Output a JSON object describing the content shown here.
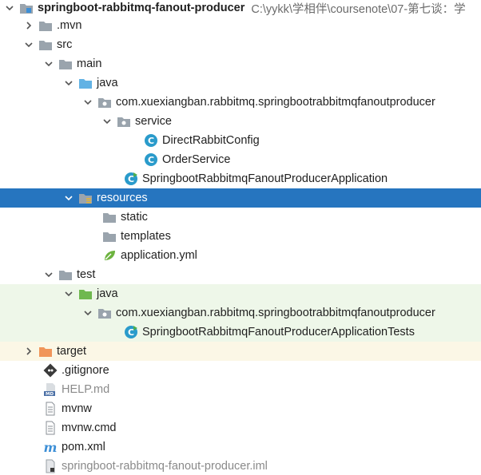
{
  "project": {
    "name": "springboot-rabbitmq-fanout-producer",
    "path": "C:\\yykk\\学相伴\\coursenote\\07-第七谈：学"
  },
  "nodes": {
    "mvn": ".mvn",
    "src": "src",
    "main": "main",
    "main_java": "java",
    "package_main": "com.xuexiangban.rabbitmq.springbootrabbitmqfanoutproducer",
    "service": "service",
    "direct_config": "DirectRabbitConfig",
    "order_service": "OrderService",
    "app_class": "SpringbootRabbitmqFanoutProducerApplication",
    "resources": "resources",
    "static": "static",
    "templates": "templates",
    "app_yml": "application.yml",
    "test": "test",
    "test_java": "java",
    "package_test": "com.xuexiangban.rabbitmq.springbootrabbitmqfanoutproducer",
    "app_tests": "SpringbootRabbitmqFanoutProducerApplicationTests",
    "target": "target",
    "gitignore": ".gitignore",
    "help_md": "HELP.md",
    "mvnw": "mvnw",
    "mvnw_cmd": "mvnw.cmd",
    "pom": "pom.xml",
    "iml": "springboot-rabbitmq-fanout-producer.iml"
  },
  "colors": {
    "selection": "#2675bf",
    "test_background": "#eef7e9",
    "excluded_background": "#fbf7e6",
    "folder_gray": "#9aa4ad",
    "source_folder_blue": "#62b2e4",
    "test_folder_green": "#6fb84f",
    "excluded_folder_orange": "#f0955a",
    "class_icon": "#2a9bcb"
  }
}
